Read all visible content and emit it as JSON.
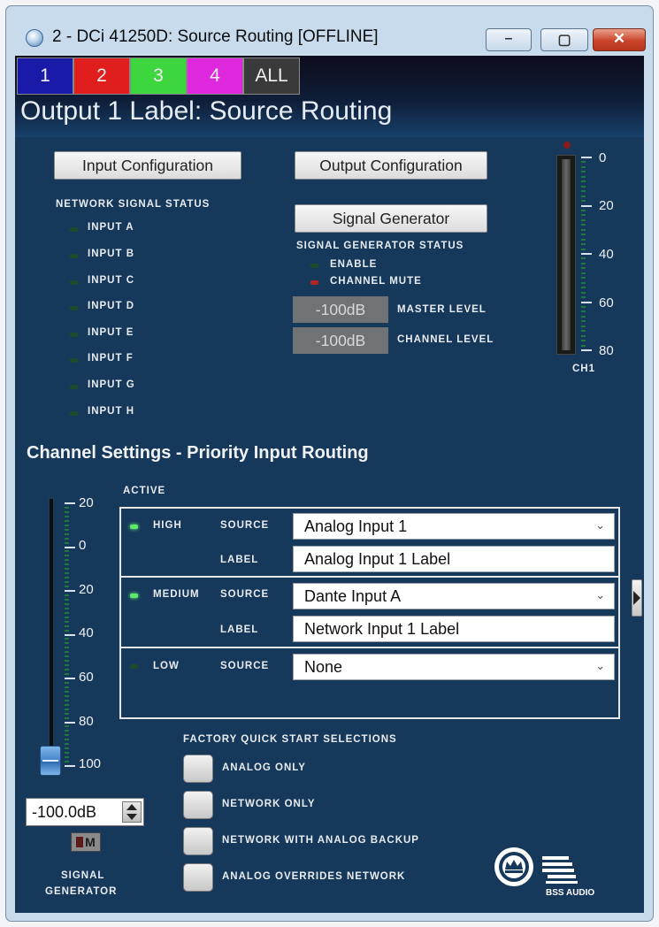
{
  "window": {
    "title": "2 - DCi 41250D: Source Routing [OFFLINE]",
    "minimize_glyph": "–",
    "maximize_glyph": "▢",
    "close_glyph": "✕"
  },
  "tabs": [
    {
      "label": "1",
      "color": "#1a1aa8"
    },
    {
      "label": "2",
      "color": "#e01e1e"
    },
    {
      "label": "3",
      "color": "#3ed63e"
    },
    {
      "label": "4",
      "color": "#de28de"
    },
    {
      "label": "ALL",
      "color": "#3a3a3a"
    }
  ],
  "output_label": "Output 1 Label: Source Routing",
  "buttons": {
    "input_configuration": "Input Configuration",
    "output_configuration": "Output Configuration",
    "signal_generator": "Signal Generator"
  },
  "network_status": {
    "title": "NETWORK SIGNAL STATUS",
    "inputs": [
      "INPUT A",
      "INPUT B",
      "INPUT C",
      "INPUT D",
      "INPUT E",
      "INPUT F",
      "INPUT G",
      "INPUT H"
    ]
  },
  "signal_generator_status": {
    "title": "SIGNAL GENERATOR STATUS",
    "enable": "ENABLE",
    "channel_mute": "CHANNEL MUTE",
    "master_level_value": "-100dB",
    "master_level_label": "MASTER LEVEL",
    "channel_level_value": "-100dB",
    "channel_level_label": "CHANNEL LEVEL"
  },
  "meter": {
    "ticks": [
      "0",
      "20",
      "40",
      "60",
      "80"
    ],
    "label": "CH1"
  },
  "channel_settings": {
    "title": "Channel Settings - Priority Input Routing",
    "active_label": "ACTIVE",
    "source_label": "SOURCE",
    "label_label": "LABEL",
    "priorities": [
      {
        "name": "HIGH",
        "source": "Analog Input 1",
        "label": "Analog Input 1 Label",
        "active": true
      },
      {
        "name": "MEDIUM",
        "source": "Dante Input A",
        "label": "Network Input 1 Label",
        "active": true
      },
      {
        "name": "LOW",
        "source": "None",
        "active": false
      }
    ]
  },
  "fader": {
    "ticks": [
      "20",
      "0",
      "20",
      "40",
      "60",
      "80",
      "100"
    ],
    "value": "-100.0dB",
    "mute_label": "M",
    "caption_line1": "SIGNAL",
    "caption_line2": "GENERATOR"
  },
  "quick_start": {
    "title": "FACTORY QUICK START SELECTIONS",
    "options": [
      "ANALOG ONLY",
      "NETWORK ONLY",
      "NETWORK WITH ANALOG BACKUP",
      "ANALOG OVERRIDES NETWORK"
    ]
  },
  "logo": {
    "text": "BSS AUDIO"
  }
}
